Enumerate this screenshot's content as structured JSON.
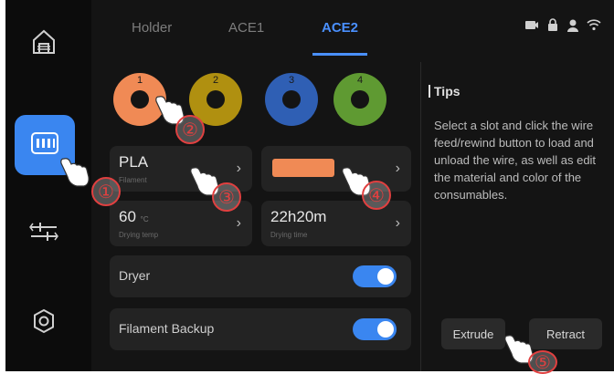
{
  "tabs": [
    {
      "label": "Holder"
    },
    {
      "label": "ACE1"
    },
    {
      "label": "ACE2"
    }
  ],
  "active_tab": "ACE2",
  "accent_color": "#3a86f0",
  "spools": [
    {
      "slot": "1",
      "color": "#f08a55"
    },
    {
      "slot": "2",
      "color": "#b09010"
    },
    {
      "slot": "3",
      "color": "#2f5fb4"
    },
    {
      "slot": "4",
      "color": "#5f9a32"
    }
  ],
  "material": {
    "value": "PLA",
    "caption": "Filament"
  },
  "filament_color": "#f08a55",
  "drying_temp": {
    "value": "60",
    "unit": "°C",
    "caption": "Drying temp"
  },
  "drying_time": {
    "value": "22h20m",
    "caption": "Drying time"
  },
  "toggles": {
    "dryer": {
      "label": "Dryer",
      "on": true
    },
    "backup": {
      "label": "Filament Backup",
      "on": true
    }
  },
  "tips": {
    "title": "Tips",
    "body": "Select a slot and click the wire feed/rewind button to load and unload the wire, as well as edit the material and color of the consumables."
  },
  "buttons": {
    "extrude": "Extrude",
    "retract": "Retract"
  },
  "callouts": [
    "①",
    "②",
    "③",
    "④",
    "⑤"
  ],
  "icons": {
    "sidebar": [
      "home-icon",
      "filament-box-icon",
      "controls-icon",
      "settings-icon"
    ],
    "status": [
      "camera-icon",
      "lock-icon",
      "user-icon",
      "wifi-icon"
    ]
  }
}
